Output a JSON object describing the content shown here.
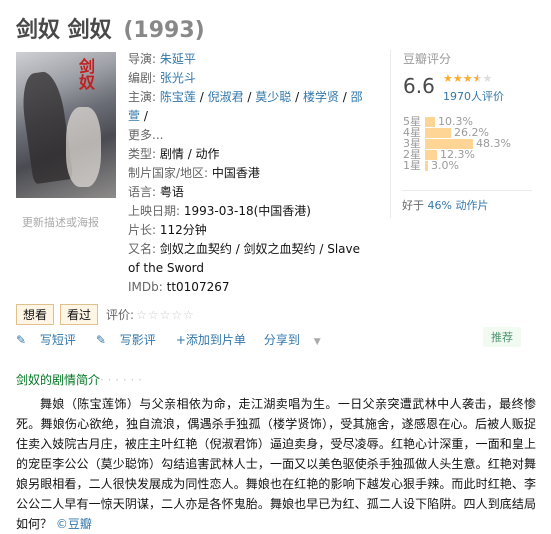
{
  "title": "剑奴 剑奴",
  "year": "(1993)",
  "poster": {
    "text": "剑奴"
  },
  "update_link": "更新描述或海报",
  "info": {
    "director_label": "导演:",
    "director": "朱延平",
    "writer_label": "编剧:",
    "writer": "张光斗",
    "cast_label": "主演:",
    "cast": [
      "陈宝莲",
      "倪淑君",
      "莫少聪",
      "楼学贤",
      "邵萱"
    ],
    "cast_more": "更多...",
    "genre_label": "类型:",
    "genre": "剧情 / 动作",
    "country_label": "制片国家/地区:",
    "country": "中国香港",
    "language_label": "语言:",
    "language": "粤语",
    "release_label": "上映日期:",
    "release": "1993-03-18(中国香港)",
    "runtime_label": "片长:",
    "runtime": "112分钟",
    "aka_label": "又名:",
    "aka": "剑奴之血契约 / 剑奴之血契约 / Slave of the Sword",
    "imdb_label": "IMDb:",
    "imdb": "tt0107267"
  },
  "rating": {
    "label": "豆瓣评分",
    "score": "6.6",
    "stars_filled": 3.5,
    "votes": "1970人评价",
    "distribution": [
      {
        "label": "5星",
        "pct": "10.3%",
        "value": 10.3
      },
      {
        "label": "4星",
        "pct": "26.2%",
        "value": 26.2
      },
      {
        "label": "3星",
        "pct": "48.3%",
        "value": 48.3
      },
      {
        "label": "2星",
        "pct": "12.3%",
        "value": 12.3
      },
      {
        "label": "1星",
        "pct": "3.0%",
        "value": 3.0
      }
    ],
    "better_prefix": "好于",
    "better_pct": "46%",
    "better_genre": "动作片"
  },
  "actions": {
    "want": "想看",
    "watched": "看过",
    "rate_label": "评价:",
    "stars": "☆☆☆☆☆"
  },
  "links": {
    "short_review": "写短评",
    "review": "写影评",
    "add_list": "+添加到片单",
    "share": "分享到",
    "recommend": "推荐"
  },
  "synopsis": {
    "title": "剑奴的剧情简介",
    "dots": "· · · · · ·",
    "text": "舞娘（陈宝莲饰）与父亲相依为命，走江湖卖唱为生。一日父亲突遭武林中人袭击，最终惨死。舞娘伤心欲绝，独自流浪，偶遇杀手独孤（楼学贤饰），受其施舍，遂感恩在心。后被人贩捉住卖入妓院古月庄，被庄主叶红艳（倪淑君饰）逼迫卖身，受尽凌辱。红艳心计深重，一面和皇上的宠臣李公公（莫少聪饰）勾结追害武林人士，一面又以美色驱使杀手独孤做人头生意。红艳对舞娘另眼相看，二人很快发展成为同性恋人。舞娘也在红艳的影响下越发心狠手辣。而此时红艳、李公公二人早有一惊天阴谋，二人亦是各怀鬼胎。舞娘也早已为红、孤二人设下陷阱。四人到底结局如何？",
    "source": "©豆瓣"
  }
}
